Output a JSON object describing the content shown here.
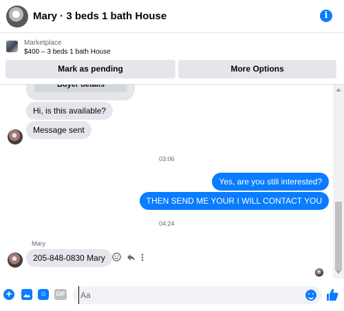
{
  "header": {
    "title": "Mary · 3 beds 1 bath House",
    "info_icon": "info-icon",
    "info_glyph": "i"
  },
  "marketplace": {
    "label": "Marketplace",
    "listing": "$400 – 3 beds 1 bath House",
    "mark_pending": "Mark as pending",
    "more_options": "More Options"
  },
  "thread": {
    "buyer_details": "Buyer details",
    "messages": [
      {
        "from": "them",
        "text": "Hi, is this available?"
      },
      {
        "from": "them",
        "text": "Message sent"
      },
      {
        "time": "03:06"
      },
      {
        "from": "me",
        "text": "Yes, are you still interested?"
      },
      {
        "from": "me",
        "text": "THEN SEND ME YOUR I WILL CONTACT YOU"
      },
      {
        "time": "04:24"
      },
      {
        "sender": "Mary"
      },
      {
        "from": "them",
        "text": "205-848-0830 Mary"
      }
    ]
  },
  "composer": {
    "placeholder": "Aa",
    "plus_glyph": "+",
    "gif_label": "GIF"
  },
  "colors": {
    "accent": "#0a7cff",
    "incoming_bubble": "#e4e6eb",
    "button_bg": "#e4e6eb"
  }
}
